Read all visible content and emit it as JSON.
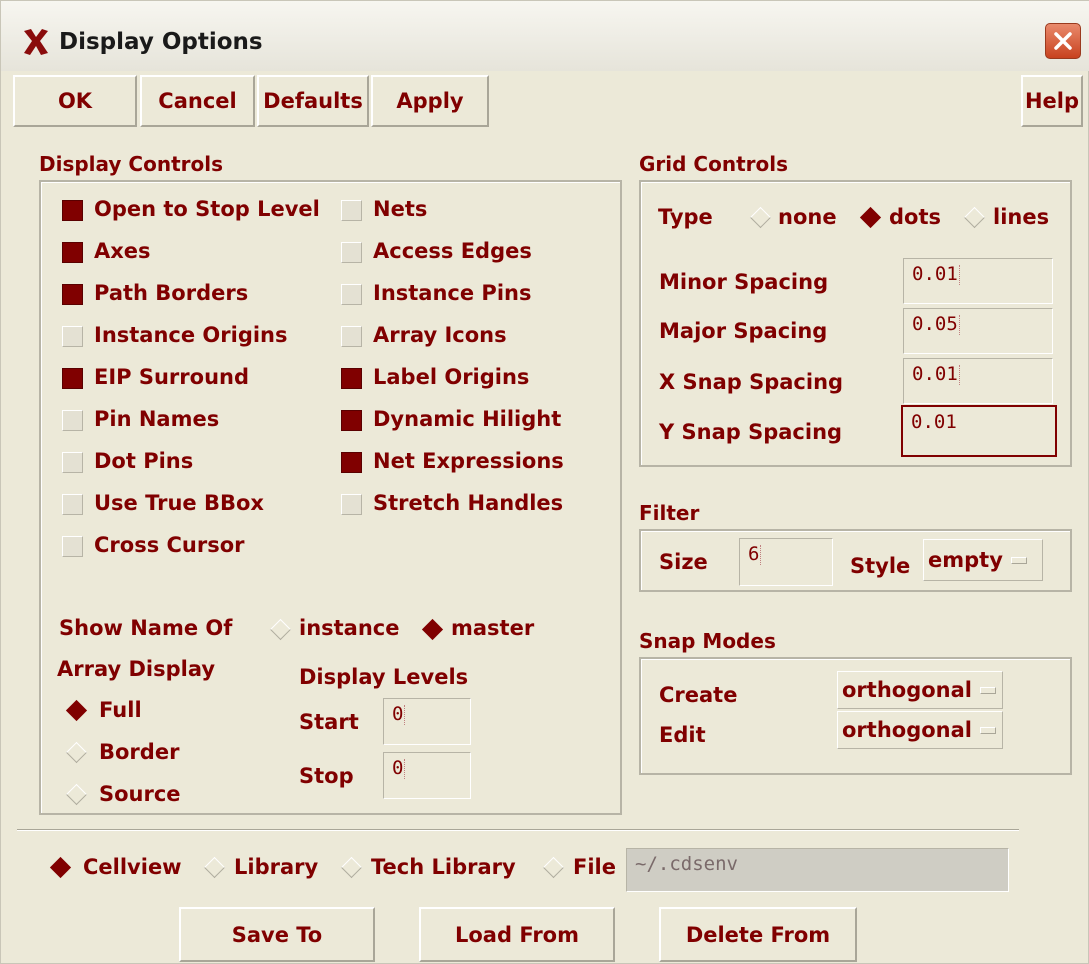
{
  "window": {
    "title": "Display Options"
  },
  "toolbar": {
    "ok": "OK",
    "cancel": "Cancel",
    "defaults": "Defaults",
    "apply": "Apply",
    "help": "Help"
  },
  "display_controls": {
    "title": "Display Controls",
    "left_items": [
      {
        "label": "Open to Stop Level",
        "checked": true
      },
      {
        "label": "Axes",
        "checked": true
      },
      {
        "label": "Path Borders",
        "checked": true
      },
      {
        "label": "Instance Origins",
        "checked": false
      },
      {
        "label": "EIP Surround",
        "checked": true
      },
      {
        "label": "Pin Names",
        "checked": false
      },
      {
        "label": "Dot Pins",
        "checked": false
      },
      {
        "label": "Use True BBox",
        "checked": false
      },
      {
        "label": "Cross Cursor",
        "checked": false
      }
    ],
    "right_items": [
      {
        "label": "Nets",
        "checked": false
      },
      {
        "label": "Access Edges",
        "checked": false
      },
      {
        "label": "Instance Pins",
        "checked": false
      },
      {
        "label": "Array Icons",
        "checked": false
      },
      {
        "label": "Label Origins",
        "checked": true
      },
      {
        "label": "Dynamic Hilight",
        "checked": true
      },
      {
        "label": "Net Expressions",
        "checked": true
      },
      {
        "label": "Stretch Handles",
        "checked": false
      }
    ],
    "show_name_of": {
      "label": "Show Name Of",
      "options": [
        "instance",
        "master"
      ],
      "selected": "master"
    },
    "array_display": {
      "label": "Array Display",
      "options": [
        "Full",
        "Border",
        "Source"
      ],
      "selected": "Full"
    },
    "display_levels": {
      "label": "Display Levels",
      "start_label": "Start",
      "start_value": "0",
      "stop_label": "Stop",
      "stop_value": "0"
    }
  },
  "grid_controls": {
    "title": "Grid Controls",
    "type_label": "Type",
    "type_options": [
      "none",
      "dots",
      "lines"
    ],
    "type_selected": "dots",
    "minor_label": "Minor Spacing",
    "minor_value": "0.01",
    "major_label": "Major Spacing",
    "major_value": "0.05",
    "xsnap_label": "X Snap Spacing",
    "xsnap_value": "0.01",
    "ysnap_label": "Y Snap Spacing",
    "ysnap_value": "0.01"
  },
  "filter": {
    "title": "Filter",
    "size_label": "Size",
    "size_value": "6",
    "style_label": "Style",
    "style_value": "empty"
  },
  "snap_modes": {
    "title": "Snap Modes",
    "create_label": "Create",
    "create_value": "orthogonal",
    "edit_label": "Edit",
    "edit_value": "orthogonal"
  },
  "save_source": {
    "options": [
      "Cellview",
      "Library",
      "Tech Library",
      "File"
    ],
    "selected": "Cellview",
    "file_value": "~/.cdsenv"
  },
  "bottom_buttons": {
    "save": "Save To",
    "load": "Load From",
    "delete": "Delete From"
  },
  "colors": {
    "accent": "#800000",
    "background": "#ece9d8"
  }
}
